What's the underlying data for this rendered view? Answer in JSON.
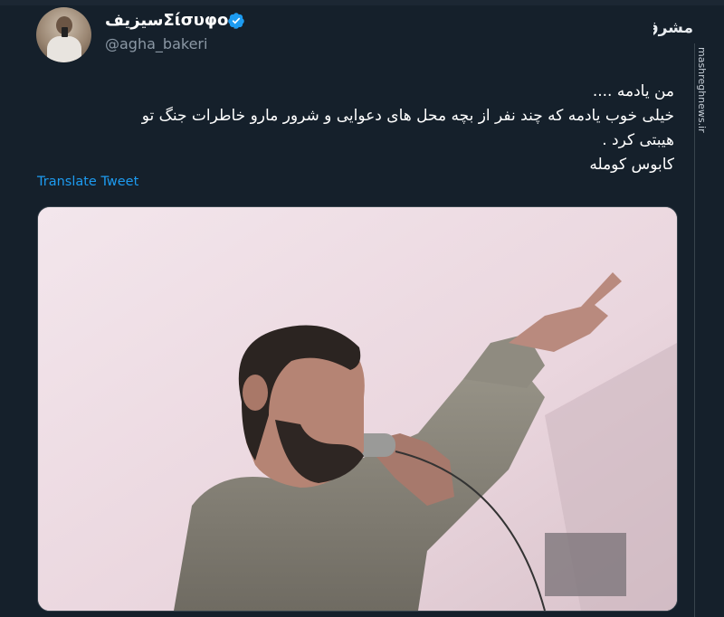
{
  "user": {
    "display_name": "سیزیفΣίσυφος",
    "handle": "@agha_bakeri",
    "verified": true
  },
  "tweet": {
    "lines": [
      "من یادمه ....",
      "خیلی خوب یادمه که چند نفر از بچه محل های دعوایی و شرور مارو خاطرات جنگ تو",
      "هیبتی کرد .",
      "کابوس کومله"
    ],
    "translate_label": "Translate Tweet"
  },
  "watermark": {
    "logo_text": "مشرق",
    "url": "mashreghnews.ir"
  },
  "colors": {
    "background": "#15202b",
    "link": "#1d9bf0",
    "secondary_text": "#8b98a5",
    "verified_badge": "#1d9bf0"
  },
  "icons": [
    "avatar-image",
    "verified-badge-icon",
    "mashregh-logo"
  ]
}
